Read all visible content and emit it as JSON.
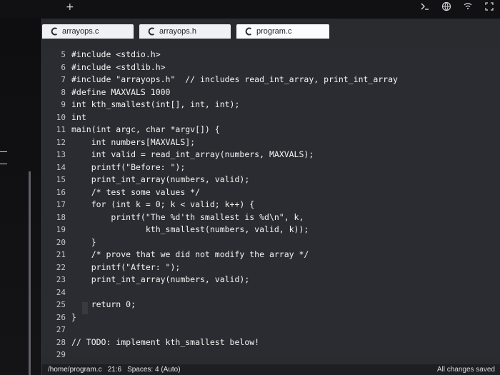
{
  "window": {
    "plus_label": "+"
  },
  "topbar": {
    "icons": [
      "terminal-icon",
      "globe-icon",
      "wifi-icon",
      "expand-icon"
    ]
  },
  "tabs": [
    {
      "label": "arrayops.c"
    },
    {
      "label": "arrayops.h"
    },
    {
      "label": "program.c",
      "active": true
    }
  ],
  "code_lines": [
    {
      "num": "5",
      "text": "#include <stdio.h>"
    },
    {
      "num": "6",
      "text": "#include <stdlib.h>"
    },
    {
      "num": "7",
      "text": "#include \"arrayops.h\"  // includes read_int_array, print_int_array"
    },
    {
      "num": "8",
      "text": "#define MAXVALS 1000"
    },
    {
      "num": "9",
      "text": "int kth_smallest(int[], int, int);"
    },
    {
      "num": "10",
      "text": "int"
    },
    {
      "num": "11",
      "text": "main(int argc, char *argv[]) {"
    },
    {
      "num": "12",
      "text": "    int numbers[MAXVALS];"
    },
    {
      "num": "13",
      "text": "    int valid = read_int_array(numbers, MAXVALS);"
    },
    {
      "num": "14",
      "text": "    printf(\"Before: \");"
    },
    {
      "num": "15",
      "text": "    print_int_array(numbers, valid);"
    },
    {
      "num": "16",
      "text": "    /* test some values */"
    },
    {
      "num": "17",
      "text": "    for (int k = 0; k < valid; k++) {"
    },
    {
      "num": "18",
      "text": "        printf(\"The %d'th smallest is %d\\n\", k,"
    },
    {
      "num": "19",
      "text": "               kth_smallest(numbers, valid, k));"
    },
    {
      "num": "20",
      "text": "    }"
    },
    {
      "num": "21",
      "text": "    /* prove that we did not modify the array */"
    },
    {
      "num": "22",
      "text": "    printf(\"After: \");"
    },
    {
      "num": "23",
      "text": "    print_int_array(numbers, valid);"
    },
    {
      "num": "24",
      "text": ""
    },
    {
      "num": "25",
      "text": "    return 0;"
    },
    {
      "num": "26",
      "text": "}"
    },
    {
      "num": "27",
      "text": ""
    },
    {
      "num": "28",
      "text": "// TODO: implement kth_smallest below!"
    },
    {
      "num": "29",
      "text": ""
    }
  ],
  "statusbar": {
    "path": "/home/program.c",
    "cursor": "21:6",
    "spaces": "Spaces: 4 (Auto)",
    "saved": "All changes saved"
  }
}
